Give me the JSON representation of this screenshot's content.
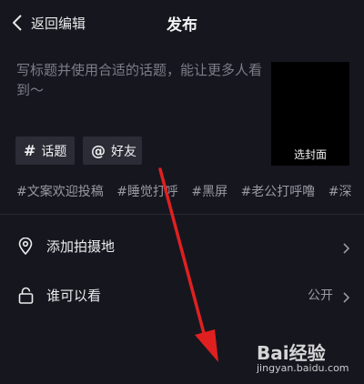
{
  "header": {
    "back_label": "返回编辑",
    "title": "发布"
  },
  "editor": {
    "placeholder": "写标题并使用合适的话题，能让更多人看到～"
  },
  "cover": {
    "label": "选封面"
  },
  "buttons": {
    "topic": {
      "symbol": "#",
      "label": "话题"
    },
    "friend": {
      "symbol": "@",
      "label": "好友"
    }
  },
  "suggested_tags": [
    "#文案欢迎投稿",
    "#睡觉打呼",
    "#黑屏",
    "#老公打呼噜",
    "#深"
  ],
  "settings": {
    "location": {
      "label": "添加拍摄地"
    },
    "visibility": {
      "label": "谁可以看",
      "value": "公开"
    }
  },
  "watermark": {
    "logo": "Bai经验",
    "url": "jingyan.baidu.com"
  },
  "colors": {
    "background": "#16161f",
    "annotation_arrow": "#e02020"
  }
}
